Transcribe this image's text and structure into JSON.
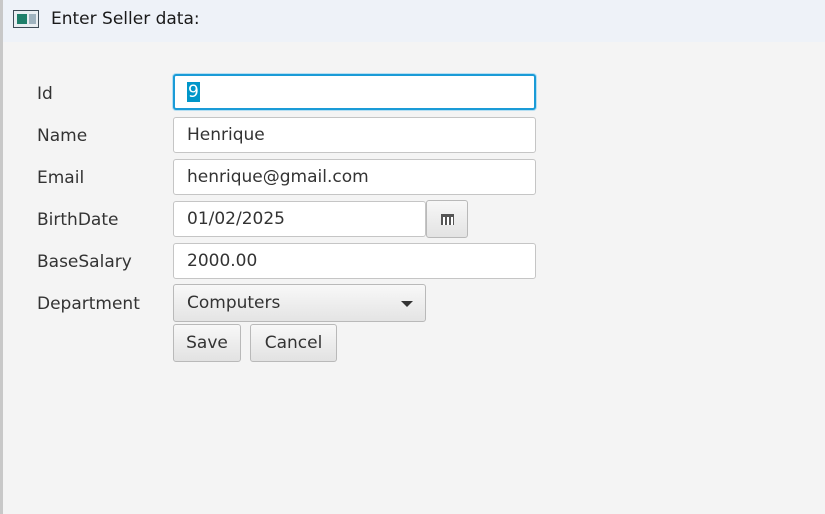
{
  "window": {
    "title": "Enter Seller data:",
    "icon": "java-app-icon"
  },
  "form": {
    "id": {
      "label": "Id",
      "value": "9"
    },
    "name": {
      "label": "Name",
      "value": "Henrique"
    },
    "email": {
      "label": "Email",
      "value": "henrique@gmail.com"
    },
    "birth_date": {
      "label": "BirthDate",
      "value": "01/02/2025",
      "picker_icon": "calendar-icon"
    },
    "base_salary": {
      "label": "BaseSalary",
      "value": "2000.00"
    },
    "department": {
      "label": "Department",
      "selected": "Computers",
      "arrow_icon": "chevron-down-icon"
    }
  },
  "buttons": {
    "save_label": "Save",
    "cancel_label": "Cancel"
  },
  "colors": {
    "focus": "#1a9bd7",
    "selection": "#0096c9",
    "background": "#f4f4f4"
  }
}
